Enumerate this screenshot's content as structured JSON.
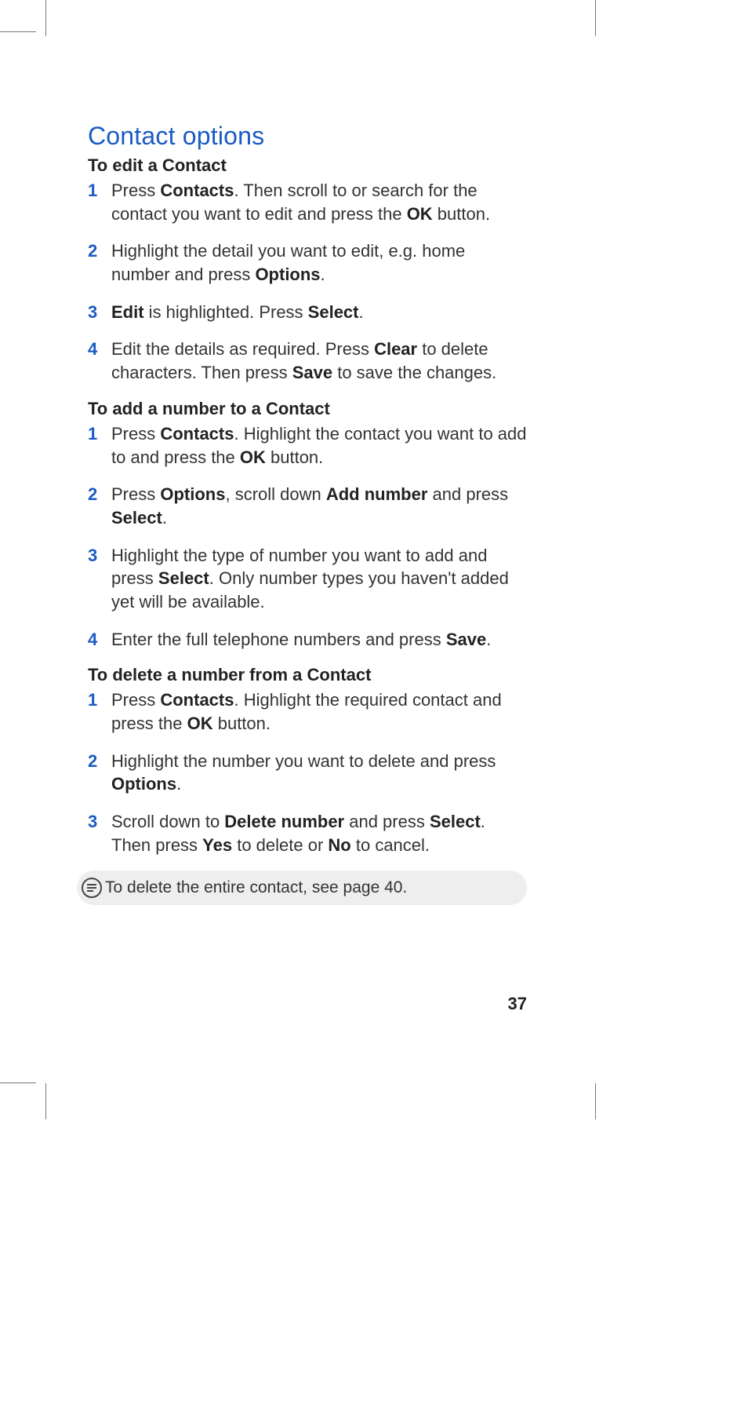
{
  "page_number": "37",
  "section_title": "Contact options",
  "sections": [
    {
      "heading": "To edit a Contact",
      "steps": [
        {
          "n": "1",
          "runs": [
            {
              "t": "Press "
            },
            {
              "t": "Contacts",
              "b": true
            },
            {
              "t": ". Then scroll to or search for the contact you want to edit and press the "
            },
            {
              "t": "OK",
              "b": true
            },
            {
              "t": " button."
            }
          ]
        },
        {
          "n": "2",
          "runs": [
            {
              "t": "Highlight the detail you want to edit, e.g. home number and press "
            },
            {
              "t": "Options",
              "b": true
            },
            {
              "t": "."
            }
          ]
        },
        {
          "n": "3",
          "runs": [
            {
              "t": "Edit",
              "b": true
            },
            {
              "t": " is highlighted. Press "
            },
            {
              "t": "Select",
              "b": true
            },
            {
              "t": "."
            }
          ]
        },
        {
          "n": "4",
          "runs": [
            {
              "t": "Edit the details as required. Press "
            },
            {
              "t": "Clear",
              "b": true
            },
            {
              "t": " to delete characters. Then press "
            },
            {
              "t": "Save",
              "b": true
            },
            {
              "t": " to save the changes."
            }
          ]
        }
      ]
    },
    {
      "heading": "To add a number to a Contact",
      "steps": [
        {
          "n": "1",
          "runs": [
            {
              "t": "Press "
            },
            {
              "t": "Contacts",
              "b": true
            },
            {
              "t": ". Highlight the contact you want to add to and press the "
            },
            {
              "t": "OK",
              "b": true
            },
            {
              "t": " button."
            }
          ]
        },
        {
          "n": "2",
          "runs": [
            {
              "t": "Press "
            },
            {
              "t": "Options",
              "b": true
            },
            {
              "t": ", scroll down "
            },
            {
              "t": "Add number",
              "b": true
            },
            {
              "t": " and press "
            },
            {
              "t": "Select",
              "b": true
            },
            {
              "t": "."
            }
          ]
        },
        {
          "n": "3",
          "runs": [
            {
              "t": "Highlight the type of number you want to add and press "
            },
            {
              "t": "Select",
              "b": true
            },
            {
              "t": ". Only number types you haven't added yet will be available."
            }
          ]
        },
        {
          "n": "4",
          "runs": [
            {
              "t": "Enter the full telephone numbers and press "
            },
            {
              "t": "Save",
              "b": true
            },
            {
              "t": "."
            }
          ]
        }
      ]
    },
    {
      "heading": "To delete a number from a Contact",
      "steps": [
        {
          "n": "1",
          "runs": [
            {
              "t": "Press "
            },
            {
              "t": "Contacts",
              "b": true
            },
            {
              "t": ". Highlight the required contact and press the "
            },
            {
              "t": "OK",
              "b": true
            },
            {
              "t": " button."
            }
          ]
        },
        {
          "n": "2",
          "runs": [
            {
              "t": "Highlight the number you want to delete and press "
            },
            {
              "t": "Options",
              "b": true
            },
            {
              "t": "."
            }
          ]
        },
        {
          "n": "3",
          "runs": [
            {
              "t": "Scroll down to "
            },
            {
              "t": "Delete number",
              "b": true
            },
            {
              "t": " and press "
            },
            {
              "t": "Select",
              "b": true
            },
            {
              "t": ". Then press "
            },
            {
              "t": "Yes",
              "b": true
            },
            {
              "t": " to delete or "
            },
            {
              "t": "No",
              "b": true
            },
            {
              "t": " to cancel."
            }
          ]
        }
      ]
    }
  ],
  "note": "To delete the entire contact, see page 40."
}
